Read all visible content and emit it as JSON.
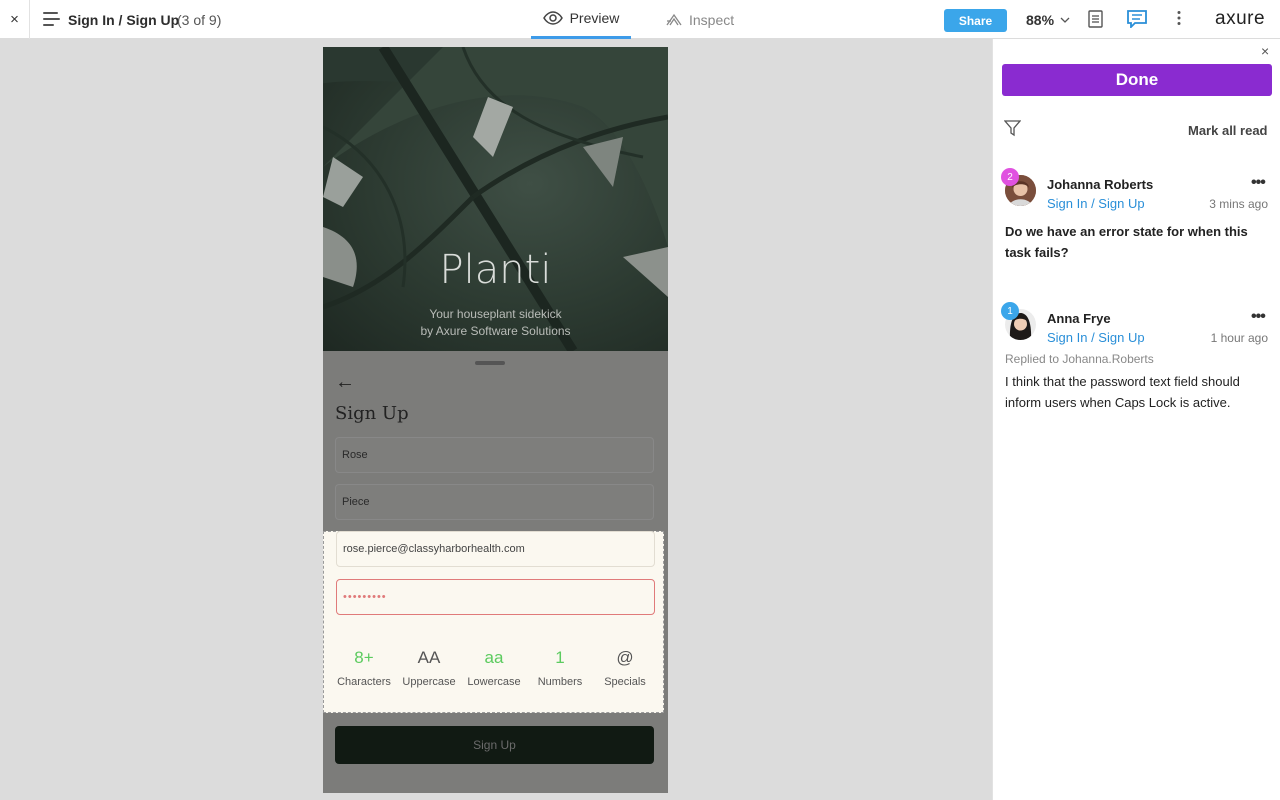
{
  "topbar": {
    "close_label": "×",
    "page_title": "Sign In / Sign Up",
    "page_count": "(3 of 9)",
    "tab_preview": "Preview",
    "tab_inspect": "Inspect",
    "share_label": "Share",
    "zoom": "88%",
    "logo": "axure"
  },
  "prototype": {
    "app_title": "Planti",
    "tagline_1": "Your houseplant sidekick",
    "tagline_2": "by Axure Software Solutions",
    "back_arrow": "←",
    "heading": "Sign Up",
    "first_name": "Rose",
    "last_name": "Piece",
    "email": "rose.pierce@classyharborhealth.com",
    "password": "•••••••••",
    "requirements": [
      {
        "symbol": "8+",
        "label": "Characters",
        "color": "#5ccb5f"
      },
      {
        "symbol": "AA",
        "label": "Uppercase",
        "color": "#555555"
      },
      {
        "symbol": "aa",
        "label": "Lowercase",
        "color": "#5ccb5f"
      },
      {
        "symbol": "1",
        "label": "Numbers",
        "color": "#5ccb5f"
      },
      {
        "symbol": "@",
        "label": "Specials",
        "color": "#555555"
      }
    ],
    "submit_label": "Sign Up"
  },
  "panel": {
    "close_label": "×",
    "done_label": "Done",
    "mark_all_read": "Mark all read",
    "comments": [
      {
        "badge": "2",
        "badge_color": "#e052e0",
        "name": "Johanna Roberts",
        "page_link": "Sign In / Sign Up",
        "time": "3 mins ago",
        "more": "•••",
        "body": "Do we have an error state for when this task fails?"
      },
      {
        "badge": "1",
        "badge_color": "#3ba6ea",
        "name": "Anna Frye",
        "page_link": "Sign In / Sign Up",
        "time": "1 hour ago",
        "more": "•••",
        "replied_to": "Replied to Johanna.Roberts",
        "body": "I think that the password text field should inform users when Caps Lock is active."
      }
    ]
  },
  "colors": {
    "accent_blue": "#3ba6ea",
    "done_purple": "#8a2bd0",
    "link_blue": "#2a8fd8",
    "error_red": "#e07a7a"
  },
  "icons": [
    "close-icon",
    "menu-icon",
    "eye-icon",
    "inspect-icon",
    "chevron-down-icon",
    "document-icon",
    "comment-icon",
    "more-vertical-icon",
    "filter-icon",
    "back-arrow-icon"
  ]
}
